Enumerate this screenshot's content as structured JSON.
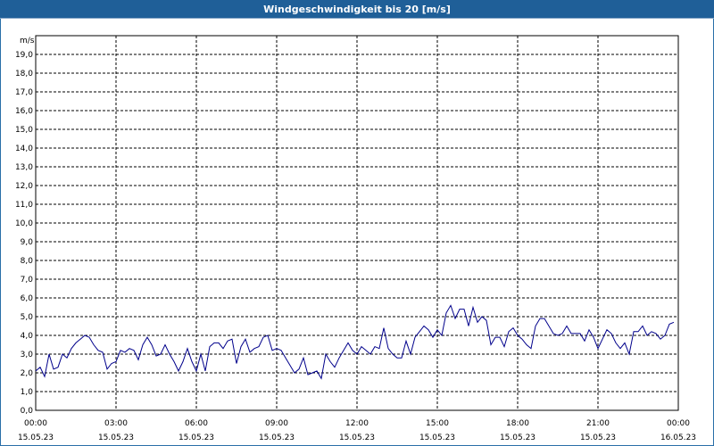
{
  "window": {
    "title": "Windgeschwindigkeit bis 20 [m/s]"
  },
  "colors": {
    "title_bar": "#1f5f98",
    "series": "#00008b",
    "grid": "#000000"
  },
  "chart_data": {
    "type": "line",
    "title": "Windgeschwindigkeit bis 20 [m/s]",
    "ylabel": "m/s",
    "xlabel": "",
    "ylim": [
      0,
      20
    ],
    "xlim": [
      "2023-05-15 00:00",
      "2023-05-16 00:00"
    ],
    "grid": true,
    "y_ticks": [
      "0,0",
      "1,0",
      "2,0",
      "3,0",
      "4,0",
      "5,0",
      "6,0",
      "7,0",
      "8,0",
      "9,0",
      "10,0",
      "11,0",
      "12,0",
      "13,0",
      "14,0",
      "15,0",
      "16,0",
      "17,0",
      "18,0",
      "19,0"
    ],
    "x_ticks": [
      {
        "time": "00:00",
        "date": "15.05.23"
      },
      {
        "time": "03:00",
        "date": "15.05.23"
      },
      {
        "time": "06:00",
        "date": "15.05.23"
      },
      {
        "time": "09:00",
        "date": "15.05.23"
      },
      {
        "time": "12:00",
        "date": "15.05.23"
      },
      {
        "time": "15:00",
        "date": "15.05.23"
      },
      {
        "time": "18:00",
        "date": "15.05.23"
      },
      {
        "time": "21:00",
        "date": "15.05.23"
      },
      {
        "time": "00:00",
        "date": "16.05.23"
      }
    ],
    "series": [
      {
        "x": [
          "00:00",
          "00:10",
          "00:20",
          "00:30",
          "00:40",
          "00:50",
          "01:00",
          "01:10",
          "01:20",
          "01:30",
          "01:40",
          "01:50",
          "02:00",
          "02:10",
          "02:20",
          "02:30",
          "02:40",
          "02:50",
          "03:00",
          "03:10",
          "03:20",
          "03:30",
          "03:40",
          "03:50",
          "04:00",
          "04:10",
          "04:20",
          "04:30",
          "04:40",
          "04:50",
          "05:00",
          "05:10",
          "05:20",
          "05:30",
          "05:40",
          "05:50",
          "06:00",
          "06:10",
          "06:20",
          "06:30",
          "06:40",
          "06:50",
          "07:00",
          "07:10",
          "07:20",
          "07:30",
          "07:40",
          "07:50",
          "08:00",
          "08:10",
          "08:20",
          "08:30",
          "08:40",
          "08:50",
          "09:00",
          "09:10",
          "09:20",
          "09:30",
          "09:40",
          "09:50",
          "10:00",
          "10:10",
          "10:20",
          "10:30",
          "10:40",
          "10:50",
          "11:00",
          "11:10",
          "11:20",
          "11:30",
          "11:40",
          "11:50",
          "12:00",
          "12:10",
          "12:20",
          "12:30",
          "12:40",
          "12:50",
          "13:00",
          "13:10",
          "13:20",
          "13:30",
          "13:40",
          "13:50",
          "14:00",
          "14:10",
          "14:20",
          "14:30",
          "14:40",
          "14:50",
          "15:00",
          "15:10",
          "15:20",
          "15:30",
          "15:40",
          "15:50",
          "16:00",
          "16:10",
          "16:20",
          "16:30",
          "16:40",
          "16:50",
          "17:00",
          "17:10",
          "17:20",
          "17:30",
          "17:40",
          "17:50",
          "18:00",
          "18:10",
          "18:20",
          "18:30",
          "18:40",
          "18:50",
          "19:00",
          "19:10",
          "19:20",
          "19:30",
          "19:40",
          "19:50",
          "20:00",
          "20:10",
          "20:20",
          "20:30",
          "20:40",
          "20:50",
          "21:00",
          "21:10",
          "21:20",
          "21:30",
          "21:40",
          "21:50",
          "22:00",
          "22:10",
          "22:20",
          "22:30",
          "22:40",
          "22:50",
          "23:00",
          "23:10",
          "23:20",
          "23:30",
          "23:40",
          "23:50"
        ],
        "values": [
          2.1,
          2.3,
          1.8,
          3.0,
          2.2,
          2.3,
          3.0,
          2.8,
          3.3,
          3.6,
          3.8,
          4.0,
          3.9,
          3.5,
          3.2,
          3.1,
          2.2,
          2.5,
          2.6,
          3.2,
          3.1,
          3.3,
          3.2,
          2.7,
          3.5,
          3.9,
          3.5,
          2.9,
          3.0,
          3.5,
          3.0,
          2.6,
          2.1,
          2.6,
          3.3,
          2.6,
          2.1,
          3.0,
          2.1,
          3.4,
          3.6,
          3.6,
          3.3,
          3.7,
          3.8,
          2.5,
          3.4,
          3.8,
          3.1,
          3.3,
          3.4,
          3.9,
          4.0,
          3.2,
          3.3,
          3.2,
          2.8,
          2.4,
          2.0,
          2.2,
          2.8,
          1.9,
          2.0,
          2.1,
          1.7,
          3.0,
          2.6,
          2.3,
          2.8,
          3.2,
          3.6,
          3.2,
          3.0,
          3.4,
          3.2,
          3.0,
          3.4,
          3.3,
          4.4,
          3.3,
          3.0,
          2.8,
          2.8,
          3.7,
          3.0,
          3.9,
          4.2,
          4.5,
          4.3,
          3.9,
          4.3,
          4.0,
          5.2,
          5.6,
          4.9,
          5.4,
          5.4,
          4.5,
          5.5,
          4.7,
          5.0,
          4.8,
          3.5,
          3.9,
          3.9,
          3.4,
          4.2,
          4.4,
          4.0,
          3.8,
          3.5,
          3.3,
          4.5,
          4.9,
          4.9,
          4.5,
          4.1,
          4.0,
          4.1,
          4.5,
          4.1,
          4.1,
          4.1,
          3.7,
          4.3,
          3.9,
          3.3,
          3.8,
          4.3,
          4.1,
          3.6,
          3.3,
          3.6,
          3.0,
          4.2,
          4.2,
          4.5,
          4.0,
          4.2,
          4.1,
          3.8,
          4.0,
          4.6,
          4.7
        ]
      }
    ]
  }
}
